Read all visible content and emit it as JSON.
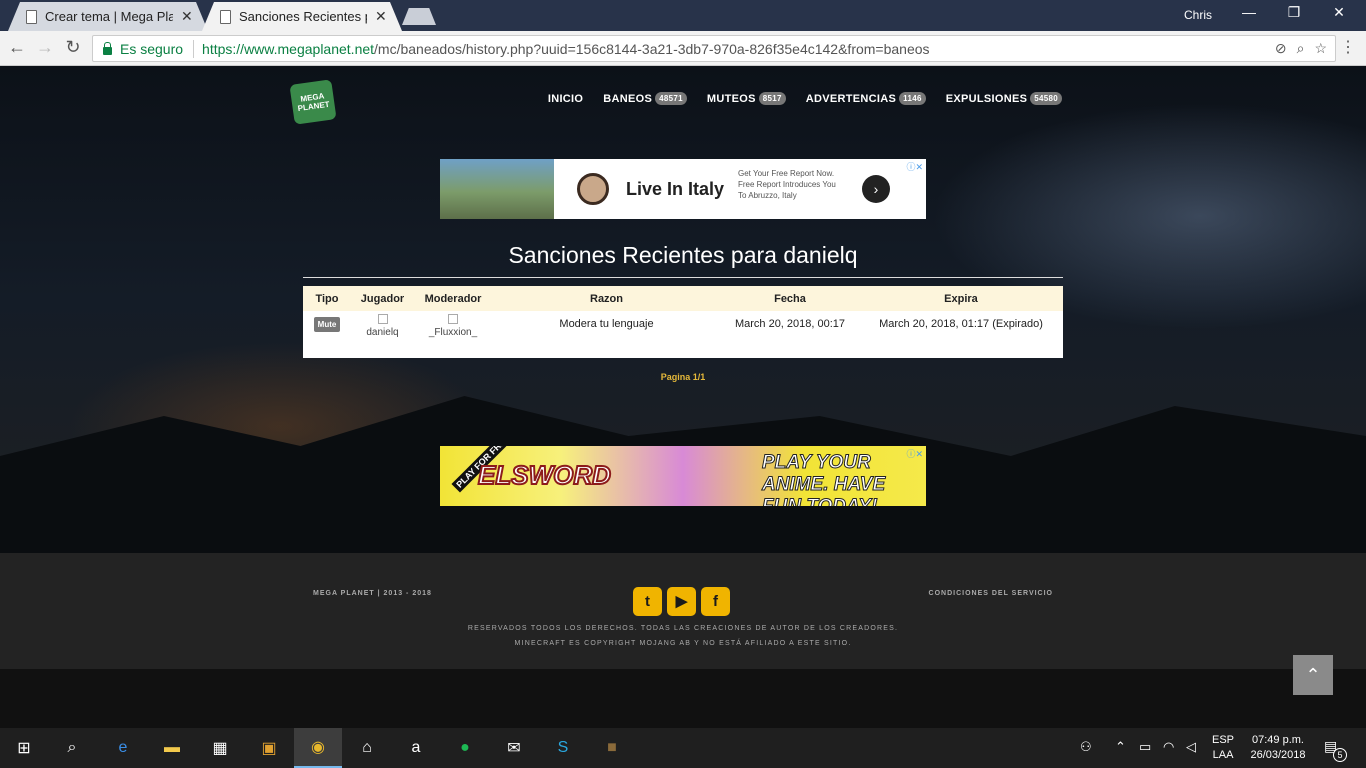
{
  "browser": {
    "tabs": [
      {
        "title": "Crear tema | Mega Planet",
        "active": false
      },
      {
        "title": "Sanciones Recientes para danielq",
        "active": true
      }
    ],
    "user": "Chris",
    "window_buttons": {
      "minimize": "—",
      "restore": "❐",
      "close": "✕"
    },
    "nav": {
      "back": "←",
      "forward": "→",
      "reload": "↻"
    },
    "secure_label": "Es seguro",
    "url_host": "https://www.megaplanet.net",
    "url_path": "/mc/baneados/history.php?uuid=156c8144-3a21-3db7-970a-826f35e4c142&from=baneos"
  },
  "site": {
    "logo_text": "MEGA PLANET",
    "nav": [
      {
        "label": "INICIO",
        "badge": ""
      },
      {
        "label": "BANEOS",
        "badge": "48571"
      },
      {
        "label": "MUTEOS",
        "badge": "8517"
      },
      {
        "label": "ADVERTENCIAS",
        "badge": "1146"
      },
      {
        "label": "EXPULSIONES",
        "badge": "54580"
      }
    ]
  },
  "ad_top": {
    "headline": "Live In Italy",
    "body": "Get Your Free Report Now. Free Report Introduces You To Abruzzo, Italy",
    "close": "ⓘ✕"
  },
  "main": {
    "title": "Sanciones Recientes para danielq",
    "columns": [
      "Tipo",
      "Jugador",
      "Moderador",
      "Razon",
      "Fecha",
      "Expira"
    ],
    "rows": [
      {
        "tipo": "Mute",
        "jugador": "danielq",
        "moderador": "_Fluxxion_",
        "razon": "Modera tu lenguaje",
        "fecha": "March 20, 2018, 00:17",
        "expira": "March 20, 2018, 01:17 (Expirado)"
      }
    ],
    "pagination": "Pagina 1/1"
  },
  "ad_bottom": {
    "corner": "PLAY FOR FREE!",
    "brand": "ELSWORD",
    "tagline": "PLAY YOUR ANIME. HAVE FUN TODAY!",
    "close": "ⓘ✕"
  },
  "footer": {
    "left": "MEGA PLANET | 2013 - 2018",
    "right": "CONDICIONES DEL SERVICIO",
    "line1": "RESERVADOS TODOS LOS DERECHOS. TODAS LAS CREACIONES DE AUTOR DE LOS CREADORES.",
    "line2": "MINECRAFT ES COPYRIGHT MOJANG AB Y NO ESTÁ AFILIADO A ESTE SITIO.",
    "social": [
      "twitter-icon",
      "youtube-icon",
      "facebook-icon"
    ]
  },
  "taskbar": {
    "lang_top": "ESP",
    "lang_bottom": "LAA",
    "time": "07:49 p.m.",
    "date": "26/03/2018",
    "notifications": "5",
    "apps": [
      "windows-start-icon",
      "search-icon",
      "edge-icon",
      "file-explorer-icon",
      "store-icon",
      "app-icon",
      "chrome-icon",
      "home-icon",
      "amazon-icon",
      "spotify-icon",
      "mail-icon",
      "skype-icon",
      "minecraft-icon"
    ]
  }
}
